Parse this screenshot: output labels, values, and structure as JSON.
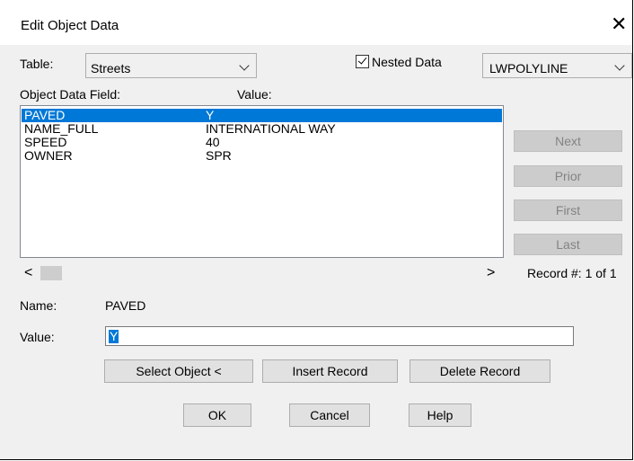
{
  "title": "Edit Object Data",
  "table_label": "Table:",
  "table_value": "Streets",
  "nested_checked": true,
  "nested_label": "Nested Data",
  "object_type_value": "LWPOLYLINE",
  "field_header": "Object Data Field:",
  "value_header": "Value:",
  "rows": [
    {
      "field": "PAVED",
      "value": "Y",
      "selected": true
    },
    {
      "field": "NAME_FULL",
      "value": "INTERNATIONAL WAY",
      "selected": false
    },
    {
      "field": "SPEED",
      "value": "40",
      "selected": false
    },
    {
      "field": "OWNER",
      "value": "SPR",
      "selected": false
    }
  ],
  "nav": {
    "next": "Next",
    "prior": "Prior",
    "first": "First",
    "last": "Last"
  },
  "record_label": "Record #: 1 of 1",
  "name_label": "Name:",
  "name_value": "PAVED",
  "value_label": "Value:",
  "value_input": "Y",
  "buttons": {
    "select_object": "Select Object <",
    "insert_record": "Insert Record",
    "delete_record": "Delete Record",
    "ok": "OK",
    "cancel": "Cancel",
    "help": "Help"
  },
  "icons": {
    "close": "close-icon",
    "scroll_left": "chevron-left-icon",
    "scroll_right": "chevron-right-icon"
  },
  "colors": {
    "selection": "#0078d7",
    "dialog_bg": "#f0f0f0",
    "disabled_text": "#838383"
  }
}
